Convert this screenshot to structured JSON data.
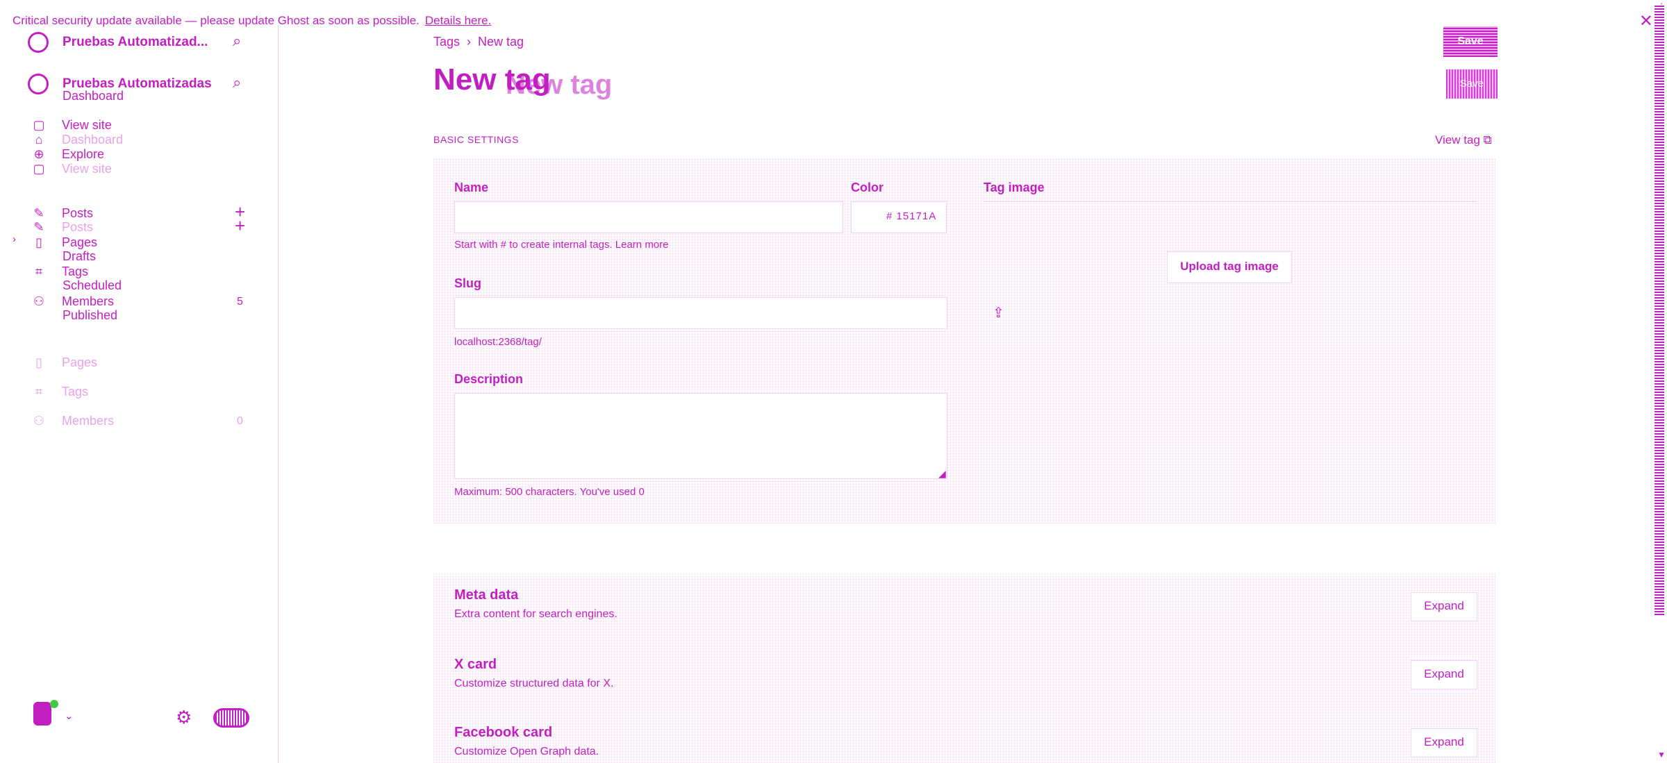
{
  "banner": {
    "text": "Critical security update available — please update Ghost as soon as possible.",
    "link": "Details here."
  },
  "sidebar": {
    "site_name_top": "Pruebas Automatizad...",
    "site_name_ghost": "Pruebas Automatizadas",
    "nav_top": [
      "Dashboard",
      "View site",
      "Explore"
    ],
    "nav_ghost": [
      "Dashboard",
      "View site"
    ],
    "posts": "Posts",
    "posts_ghost": "Posts",
    "pages": "Pages",
    "tags": "Tags",
    "members": "Members",
    "members_count": "5",
    "sub_items": [
      "Drafts",
      "Scheduled",
      "Published"
    ],
    "pages_ghost": "Pages",
    "tags_ghost": "Tags",
    "members_ghost": "Members",
    "members_count_ghost": "0"
  },
  "header": {
    "breadcrumb_parent": "Tags",
    "breadcrumb_current": "New tag",
    "title": "New tag",
    "title_ghost": "New tag",
    "save_label": "Save",
    "save_label_ghost": "Save"
  },
  "basic_settings": {
    "section_label": "BASIC SETTINGS",
    "view_tag": "View tag",
    "name_label": "Name",
    "color_label": "Color",
    "color_value": "# 15171A",
    "name_hint": "Start with # to create internal tags. Learn more",
    "slug_label": "Slug",
    "slug_hint": "localhost:2368/tag/",
    "description_label": "Description",
    "description_hint": "Maximum: 500 characters. You've used 0",
    "tag_image_label": "Tag image",
    "upload_label": "Upload tag image"
  },
  "cards": [
    {
      "title": "Meta data",
      "desc": "Extra content for search engines.",
      "button": "Expand"
    },
    {
      "title": "X card",
      "desc": "Customize structured data for X.",
      "button": "Expand"
    },
    {
      "title": "Facebook card",
      "desc": "Customize Open Graph data.",
      "button": "Expand"
    }
  ],
  "colors": {
    "accent": "#c21fc2",
    "success_dot": "#43c943"
  }
}
